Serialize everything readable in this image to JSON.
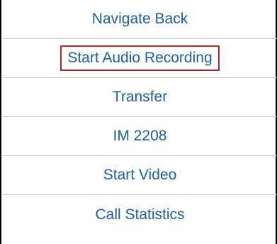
{
  "action_menu": {
    "items": [
      {
        "label": "Navigate Back",
        "highlighted": false
      },
      {
        "label": "Start Audio Recording",
        "highlighted": true
      },
      {
        "label": "Transfer",
        "highlighted": false
      },
      {
        "label": "IM 2208",
        "highlighted": false
      },
      {
        "label": "Start Video",
        "highlighted": false
      },
      {
        "label": "Call Statistics",
        "highlighted": false
      }
    ],
    "text_color": "#1a5fa8",
    "highlight_color": "#b12a2a",
    "separator_color": "#c8c7cc"
  }
}
